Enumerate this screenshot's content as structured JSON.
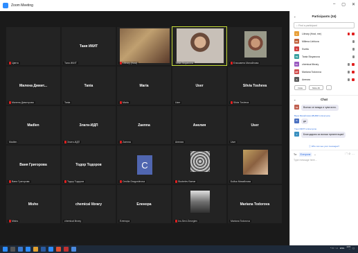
{
  "window": {
    "title": "Zoom Meeting",
    "controls": [
      "–",
      "▢",
      "✕"
    ]
  },
  "grid": [
    {
      "center": "",
      "label": "Цветя",
      "mic_off": true
    },
    {
      "center": "Таня ИКИТ",
      "label": "Таня ИКИТ",
      "mic_off": false
    },
    {
      "center": "",
      "label": "Library (Host)",
      "mic_off": true,
      "photo": "woman-laptop"
    },
    {
      "center": "",
      "label": "Tania Stoyanova",
      "mic_off": false,
      "photo": "woman-active",
      "active": true
    },
    {
      "center": "",
      "label": "Елисавета Михайлова",
      "mic_off": true,
      "photo": "woman-portrait"
    },
    {
      "center": "Милена Димит...",
      "label": "Милена Димитрова",
      "mic_off": true
    },
    {
      "center": "Tania",
      "label": "Tania",
      "mic_off": false
    },
    {
      "center": "Maria",
      "label": "Maria",
      "mic_off": true
    },
    {
      "center": "User",
      "label": "User",
      "mic_off": false
    },
    {
      "center": "Silvia Tosheva",
      "label": "Silvia Tosheva",
      "mic_off": true
    },
    {
      "center": "Madlen",
      "label": "Madlen",
      "mic_off": false
    },
    {
      "center": "Злати-ИДП",
      "label": "Злати-ИДП",
      "mic_off": true
    },
    {
      "center": "Zaenna",
      "label": "Zaenna",
      "mic_off": true
    },
    {
      "center": "Анелия",
      "label": "Анелия",
      "mic_off": false
    },
    {
      "center": "User",
      "label": "User",
      "mic_off": false
    },
    {
      "center": "Ваня Григорова",
      "label": "Ваня Григорова",
      "mic_off": true
    },
    {
      "center": "Тодор Тодоров",
      "label": "Тодор Тодоров",
      "mic_off": true
    },
    {
      "center": "",
      "label": "Cecilia Dragostinova",
      "mic_off": true,
      "initial": "C"
    },
    {
      "center": "",
      "label": "Skobelev Ванче",
      "mic_off": true,
      "photo": "pattern"
    },
    {
      "center": "",
      "label": "Бойка Михайлова",
      "mic_off": false,
      "photo": "woman-flowers"
    },
    {
      "center": "Misho",
      "label": "Misho",
      "mic_off": true
    },
    {
      "center": "chemical library",
      "label": "chemical library",
      "mic_off": false
    },
    {
      "center": "Еленора",
      "label": "Еленора",
      "mic_off": false
    },
    {
      "center": "",
      "label": "Ivo-Sevi-Georgiev",
      "mic_off": true,
      "photo": "bw-photo"
    },
    {
      "center": "Mariana Todorova",
      "label": "Mariana Todorova",
      "mic_off": false
    }
  ],
  "participants": {
    "title": "Participants (34)",
    "search_placeholder": "Find a participant",
    "items": [
      {
        "initial": "L",
        "name": "Library (Host, me)",
        "color": "#e8a03a",
        "mic_off": true,
        "cam_off": true
      },
      {
        "initial": "ML",
        "name": "Millena Uzhlova",
        "color": "#c0603a",
        "mic_off": false,
        "cam_off": false
      },
      {
        "initial": "S",
        "name": "Svetla",
        "color": "#d04040",
        "mic_off": false,
        "cam_off": false
      },
      {
        "initial": "TS",
        "name": "Tania Stoyanova",
        "color": "#3aa0a0",
        "mic_off": false,
        "cam_off": false
      },
      {
        "initial": "CL",
        "name": "chemical library",
        "color": "#9a5ac0",
        "mic_off": false,
        "cam_off": true
      },
      {
        "initial": "MT",
        "name": "Mariana Todorova",
        "color": "#d05050",
        "mic_off": false,
        "cam_off": true
      },
      {
        "initial": "A",
        "name": "Анелия",
        "color": "#5a5a5a",
        "mic_off": false,
        "cam_off": true
      }
    ],
    "invite_label": "Invite",
    "mute_all_label": "Mute All",
    "more_label": "..."
  },
  "chat": {
    "title": "Chat",
    "messages": [
      {
        "sender": "",
        "initial": "ЧЕ",
        "color": "#c06050",
        "text": "Всичко се вижда и чува ясно."
      },
      {
        "sender": "Вера Михайлова НБНБМ to Everyone",
        "initial": "В",
        "color": "#4a70c0",
        "text": "да"
      },
      {
        "sender": "Таня ИКИТ to Everyone",
        "initial": "Т",
        "color": "#3a90c0",
        "text": "Благодарим за всички презентации!"
      }
    ],
    "who_sees": "Who can see your messages?",
    "to_label": "To:",
    "to_value": "Everyone",
    "input_placeholder": "Type message here..."
  },
  "taskbar": {
    "lang": "ENG",
    "time": "13:5",
    "date": "..."
  }
}
